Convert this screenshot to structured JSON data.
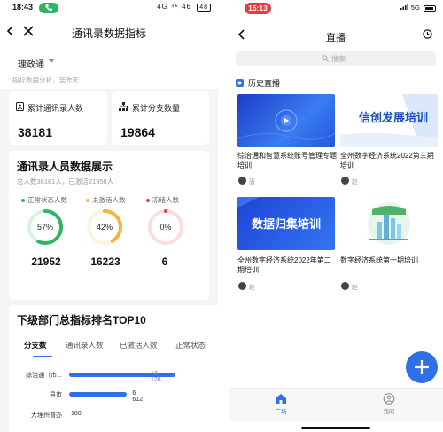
{
  "left": {
    "status": {
      "time": "18:43",
      "net": "4G ⁴⁶ 46",
      "battery": "48"
    },
    "nav": {
      "title": "通讯录数据指标"
    },
    "org": {
      "name": "理政通",
      "subtitle": "指标数据分析，至昨天"
    },
    "stats": [
      {
        "label": "累计通讯录人数",
        "value": "38181"
      },
      {
        "label": "累计分支数量",
        "value": "19864"
      }
    ],
    "display": {
      "title": "通讯录人员数据展示",
      "subtitle": "总人数38181人，已激活21958人",
      "legend": [
        "正常状态人数",
        "未激活人数",
        "冻结人数"
      ],
      "gauges": [
        {
          "percent_text": "57%",
          "percent": 57,
          "value": "21952",
          "color": "#2fb463"
        },
        {
          "percent_text": "42%",
          "percent": 42,
          "value": "16223",
          "color": "#f2b63c"
        },
        {
          "percent_text": "0%",
          "percent": 0,
          "value": "6",
          "color": "#e6453e"
        }
      ]
    },
    "ranking": {
      "title": "下级部门总指标排名TOP10",
      "tabs": [
        "分支数",
        "通讯录人数",
        "已激活人数",
        "正常状态"
      ],
      "bars": [
        {
          "label": "综治通（市...",
          "value": 12126,
          "value_text": "12 126"
        },
        {
          "label": "县市",
          "value": 6612,
          "value_text": "6 612"
        },
        {
          "label": "大理州普办",
          "value": 160,
          "value_text": "160"
        }
      ]
    }
  },
  "right": {
    "status": {
      "time": "15:13",
      "net": "5G"
    },
    "nav": {
      "title": "直播"
    },
    "search": {
      "placeholder": "搜索"
    },
    "history_label": "历史直播",
    "items": [
      {
        "title": "综治通和智慧系统账号管理专题培训",
        "author": "唐"
      },
      {
        "title": "全州数字经济系统2022第三期培训",
        "author": "赵"
      },
      {
        "title": "全州数字经济系统2022年第二期培训",
        "author": "赵"
      },
      {
        "title": "数字经济系统第一期培训",
        "author": "赵"
      }
    ],
    "thumbs": [
      "",
      "信创发展培训",
      "数据归集培训",
      ""
    ],
    "tabs": [
      "广场",
      "我的"
    ]
  },
  "colors": {
    "accent": "#2f6fe8",
    "green": "#2fb463",
    "orange": "#f2b63c",
    "red": "#e6453e"
  },
  "icons": [
    "back-icon",
    "close-icon",
    "users-icon",
    "org-chart-icon",
    "clock-icon",
    "search-icon",
    "history-icon",
    "play-icon",
    "plus-icon",
    "home-icon",
    "profile-icon"
  ]
}
